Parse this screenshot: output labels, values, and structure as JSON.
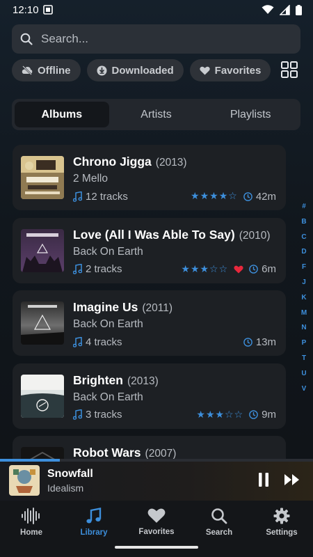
{
  "status": {
    "time": "12:10"
  },
  "search": {
    "placeholder": "Search..."
  },
  "filters": [
    {
      "label": "Offline",
      "icon": "cloud-off-icon"
    },
    {
      "label": "Downloaded",
      "icon": "download-circle-icon"
    },
    {
      "label": "Favorites",
      "icon": "heart-icon"
    }
  ],
  "tabs": [
    {
      "label": "Albums",
      "active": true
    },
    {
      "label": "Artists",
      "active": false
    },
    {
      "label": "Playlists",
      "active": false
    }
  ],
  "albums": [
    {
      "title": "Chrono Jigga",
      "year": "(2013)",
      "artist": "2 Mello",
      "tracks": "12 tracks",
      "rating": 4,
      "favorite": false,
      "duration": "42m"
    },
    {
      "title": "Love (All I Was Able To Say)",
      "year": "(2010)",
      "artist": "Back On Earth",
      "tracks": "2 tracks",
      "rating": 3,
      "favorite": true,
      "duration": "6m"
    },
    {
      "title": "Imagine Us",
      "year": "(2011)",
      "artist": "Back On Earth",
      "tracks": "4 tracks",
      "rating": 0,
      "favorite": false,
      "duration": "13m"
    },
    {
      "title": "Brighten",
      "year": "(2013)",
      "artist": "Back On Earth",
      "tracks": "3 tracks",
      "rating": 3,
      "favorite": false,
      "duration": "9m"
    },
    {
      "title": "Robot Wars",
      "year": "(2007)",
      "artist": "",
      "tracks": "",
      "rating": 0,
      "favorite": false,
      "duration": ""
    }
  ],
  "alpha_index": [
    "#",
    "B",
    "C",
    "D",
    "F",
    "J",
    "K",
    "M",
    "N",
    "P",
    "T",
    "U",
    "V"
  ],
  "now_playing": {
    "title": "Snowfall",
    "artist": "Idealism",
    "progress": 0.19
  },
  "nav": [
    {
      "label": "Home",
      "icon": "waveform-icon",
      "active": false
    },
    {
      "label": "Library",
      "icon": "music-note-icon",
      "active": true
    },
    {
      "label": "Favorites",
      "icon": "heart-icon",
      "active": false
    },
    {
      "label": "Search",
      "icon": "search-icon",
      "active": false
    },
    {
      "label": "Settings",
      "icon": "gear-icon",
      "active": false
    }
  ],
  "colors": {
    "accent": "#3d8fdc",
    "favorite": "#e8283c",
    "card": "#1d2024"
  }
}
